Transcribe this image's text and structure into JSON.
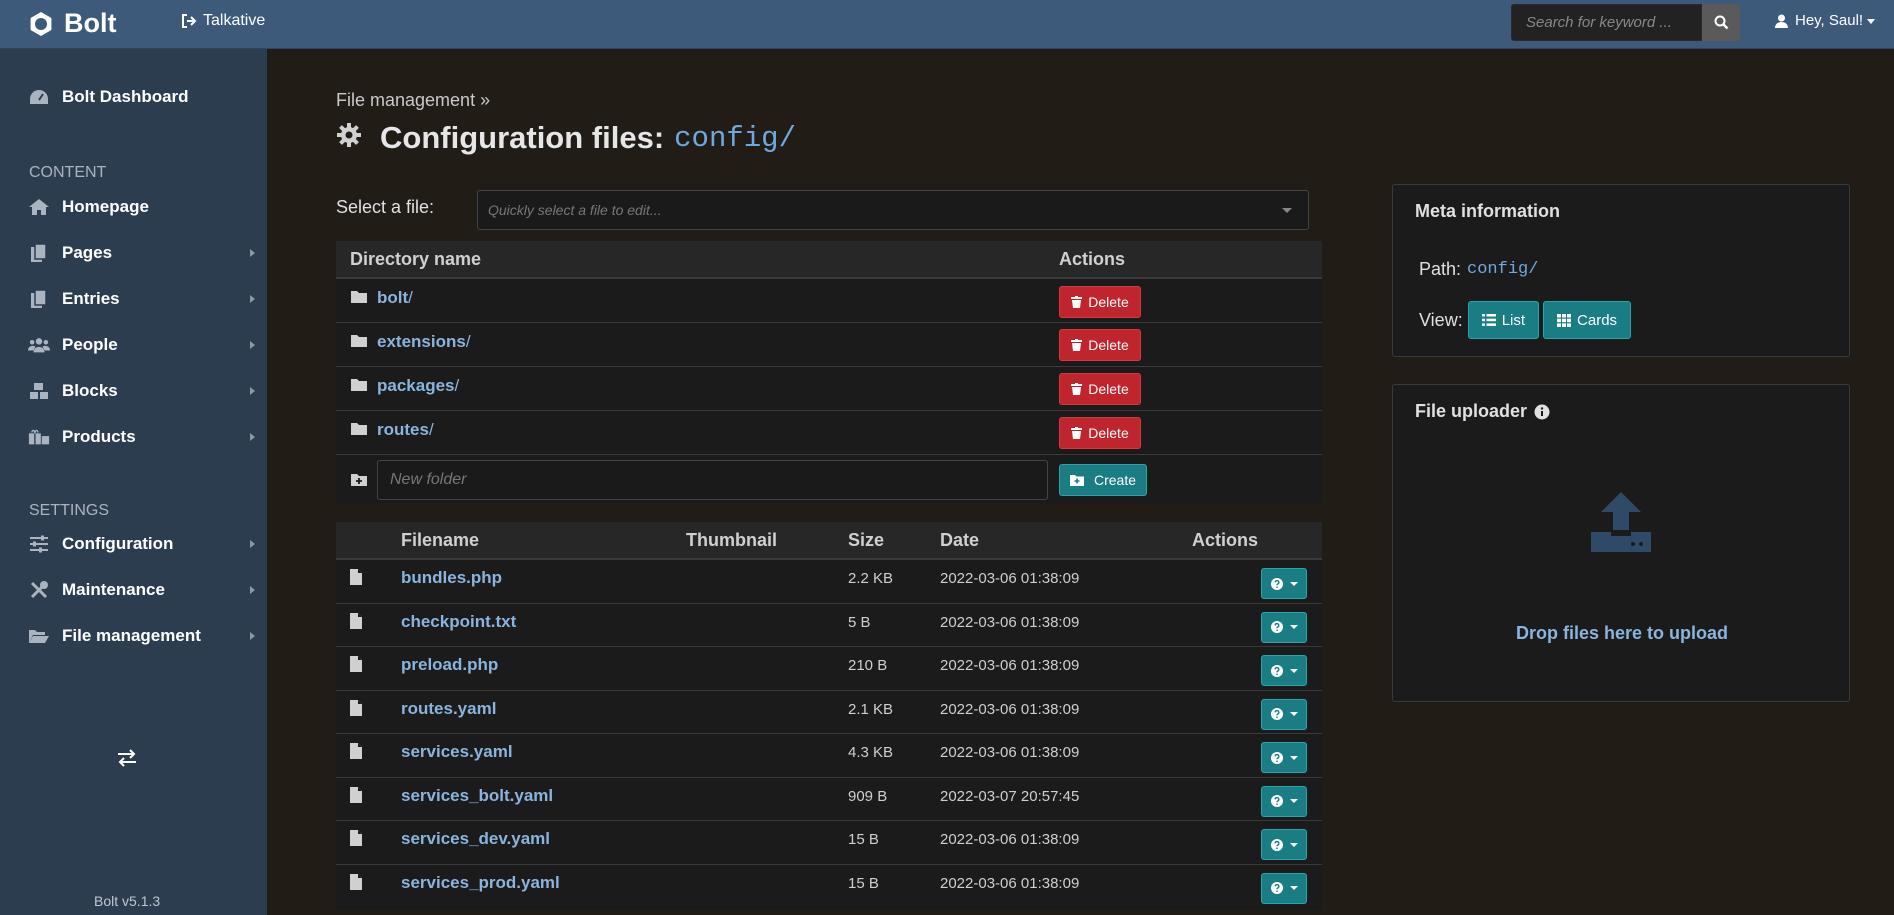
{
  "topbar": {
    "brand": "Bolt",
    "site_link": "Talkative",
    "search_placeholder": "Search for keyword ...",
    "user_greeting": "Hey, Saul!"
  },
  "sidebar": {
    "dashboard": "Bolt Dashboard",
    "content_heading": "CONTENT",
    "content_items": [
      {
        "label": "Homepage",
        "icon": "home-icon"
      },
      {
        "label": "Pages",
        "icon": "copy-icon"
      },
      {
        "label": "Entries",
        "icon": "copy-icon"
      },
      {
        "label": "People",
        "icon": "users-icon"
      },
      {
        "label": "Blocks",
        "icon": "cubes-icon"
      },
      {
        "label": "Products",
        "icon": "gifts-icon"
      }
    ],
    "settings_heading": "SETTINGS",
    "settings_items": [
      {
        "label": "Configuration",
        "icon": "sliders-icon"
      },
      {
        "label": "Maintenance",
        "icon": "tools-icon"
      },
      {
        "label": "File management",
        "icon": "folder-open-icon"
      }
    ],
    "version": "Bolt v5.1.3"
  },
  "main": {
    "breadcrumb": "File management »",
    "title": "Configuration files:",
    "title_path": "config/",
    "select_label": "Select a file:",
    "select_placeholder": "Quickly select a file to edit...",
    "dirs_table": {
      "headers": [
        "Directory name",
        "Actions"
      ],
      "rows": [
        {
          "name": "bolt",
          "suffix": "/",
          "action": "Delete"
        },
        {
          "name": "extensions",
          "suffix": "/",
          "action": "Delete"
        },
        {
          "name": "packages",
          "suffix": "/",
          "action": "Delete"
        },
        {
          "name": "routes",
          "suffix": "/",
          "action": "Delete"
        }
      ],
      "new_folder_placeholder": "New folder",
      "create_label": "Create"
    },
    "files_table": {
      "headers": [
        "Filename",
        "Thumbnail",
        "Size",
        "Date",
        "Actions"
      ],
      "rows": [
        {
          "name": "bundles.php",
          "size": "2.2 KB",
          "date": "2022-03-06 01:38:09"
        },
        {
          "name": "checkpoint.txt",
          "size": "5 B",
          "date": "2022-03-06 01:38:09"
        },
        {
          "name": "preload.php",
          "size": "210 B",
          "date": "2022-03-06 01:38:09"
        },
        {
          "name": "routes.yaml",
          "size": "2.1 KB",
          "date": "2022-03-06 01:38:09"
        },
        {
          "name": "services.yaml",
          "size": "4.3 KB",
          "date": "2022-03-06 01:38:09"
        },
        {
          "name": "services_bolt.yaml",
          "size": "909 B",
          "date": "2022-03-07 20:57:45"
        },
        {
          "name": "services_dev.yaml",
          "size": "15 B",
          "date": "2022-03-06 01:38:09"
        },
        {
          "name": "services_prod.yaml",
          "size": "15 B",
          "date": "2022-03-06 01:38:09"
        }
      ]
    }
  },
  "meta_card": {
    "title": "Meta information",
    "path_label": "Path:",
    "path_value": "config/",
    "view_label": "View:",
    "view_list": "List",
    "view_cards": "Cards"
  },
  "uploader_card": {
    "title": "File uploader",
    "drop_text": "Drop files here to upload"
  },
  "colors": {
    "topbar": "#3d5a7a",
    "sidebar": "#2d3d50",
    "danger": "#c0242d",
    "teal": "#1a7d84",
    "link": "#8ab4de"
  }
}
